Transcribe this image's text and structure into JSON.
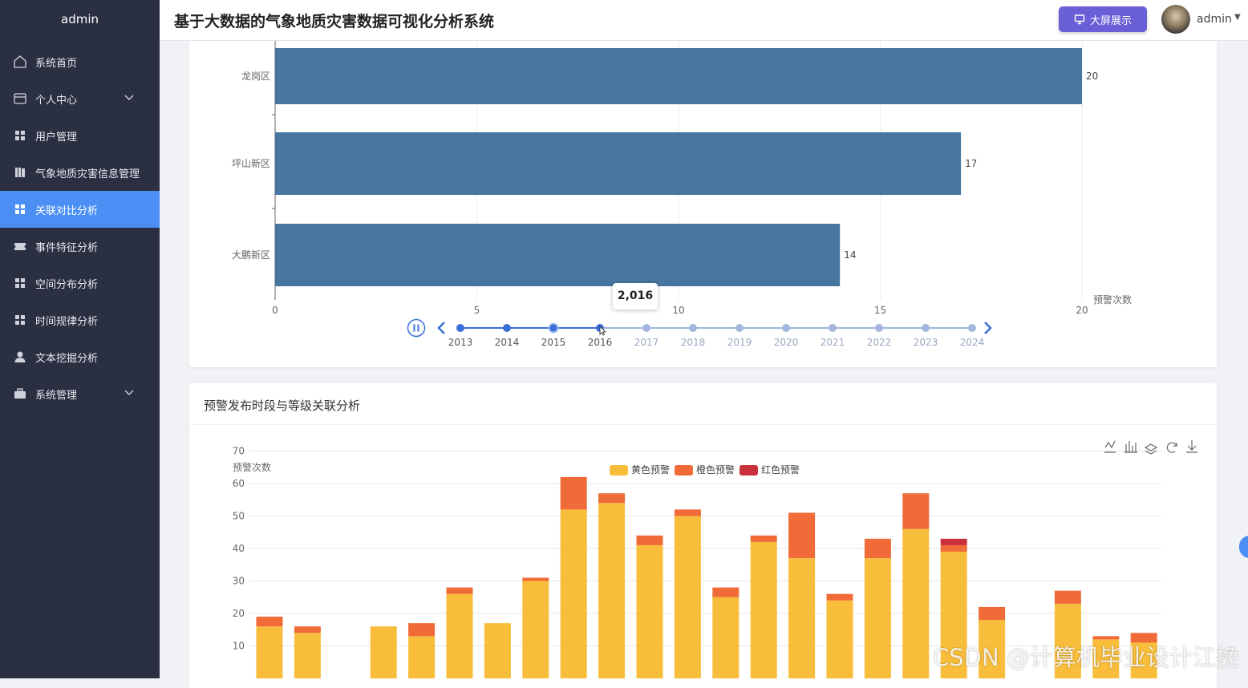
{
  "app": {
    "brand": "admin",
    "title": "基于大数据的气象地质灾害数据可视化分析系统"
  },
  "header": {
    "big_screen_label": "大屏展示",
    "user_name": "admin"
  },
  "sidebar": {
    "items": [
      {
        "label": "系统首页",
        "icon": "home-icon",
        "active": false,
        "has_children": false
      },
      {
        "label": "个人中心",
        "icon": "id-card-icon",
        "active": false,
        "has_children": true
      },
      {
        "label": "用户管理",
        "icon": "grid-icon",
        "active": false,
        "has_children": false
      },
      {
        "label": "气象地质灾害信息管理",
        "icon": "book-icon",
        "active": false,
        "has_children": false
      },
      {
        "label": "关联对比分析",
        "icon": "grid-icon",
        "active": true,
        "has_children": false
      },
      {
        "label": "事件特征分析",
        "icon": "ticket-icon",
        "active": false,
        "has_children": false
      },
      {
        "label": "空间分布分析",
        "icon": "grid-icon",
        "active": false,
        "has_children": false
      },
      {
        "label": "时间规律分析",
        "icon": "grid-icon",
        "active": false,
        "has_children": false
      },
      {
        "label": "文本挖掘分析",
        "icon": "user-icon",
        "active": false,
        "has_children": false
      },
      {
        "label": "系统管理",
        "icon": "briefcase-icon",
        "active": false,
        "has_children": true
      }
    ]
  },
  "timeline": {
    "years": [
      "2013",
      "2014",
      "2015",
      "2016",
      "2017",
      "2018",
      "2019",
      "2020",
      "2021",
      "2022",
      "2023",
      "2024"
    ],
    "current_index": 3,
    "tooltip": "2,016",
    "playing": true
  },
  "chart2_card": {
    "title": "预警发布时段与等级关联分析"
  },
  "toolbox": [
    "line-chart-icon",
    "bar-chart-icon",
    "stack-icon",
    "restore-icon",
    "download-icon"
  ],
  "watermark": "CSDN @计算机毕业设计江挽",
  "chart_data": [
    {
      "type": "bar",
      "orientation": "horizontal",
      "categories": [
        "龙岗区",
        "坪山新区",
        "大鹏新区"
      ],
      "values": [
        20,
        17,
        14
      ],
      "xlabel": "预警次数",
      "xlim": [
        0,
        20
      ],
      "xticks": [
        0,
        5,
        10,
        15,
        20
      ],
      "color": "#46759f",
      "grid": true
    },
    {
      "type": "bar",
      "stacked": true,
      "ylabel": "预警次数",
      "ylim": [
        0,
        70
      ],
      "yticks": [
        10,
        20,
        30,
        40,
        50,
        60,
        70
      ],
      "legend_position": "top-center",
      "grid": true,
      "series": [
        {
          "name": "黄色预警",
          "color": "#f8bd3a",
          "values": [
            16,
            14,
            0,
            16,
            13,
            26,
            17,
            30,
            52,
            54,
            41,
            50,
            25,
            42,
            37,
            24,
            37,
            46,
            39,
            18,
            0,
            23,
            12,
            11
          ]
        },
        {
          "name": "橙色预警",
          "color": "#f06b38",
          "values": [
            3,
            2,
            0,
            0,
            4,
            2,
            0,
            1,
            10,
            3,
            3,
            2,
            3,
            2,
            14,
            2,
            6,
            11,
            2,
            4,
            0,
            4,
            1,
            3
          ]
        },
        {
          "name": "红色预警",
          "color": "#c8303b",
          "values": [
            0,
            0,
            0,
            0,
            0,
            0,
            0,
            0,
            0,
            0,
            0,
            0,
            0,
            0,
            0,
            0,
            0,
            0,
            2,
            0,
            0,
            0,
            0,
            0
          ]
        }
      ]
    }
  ]
}
